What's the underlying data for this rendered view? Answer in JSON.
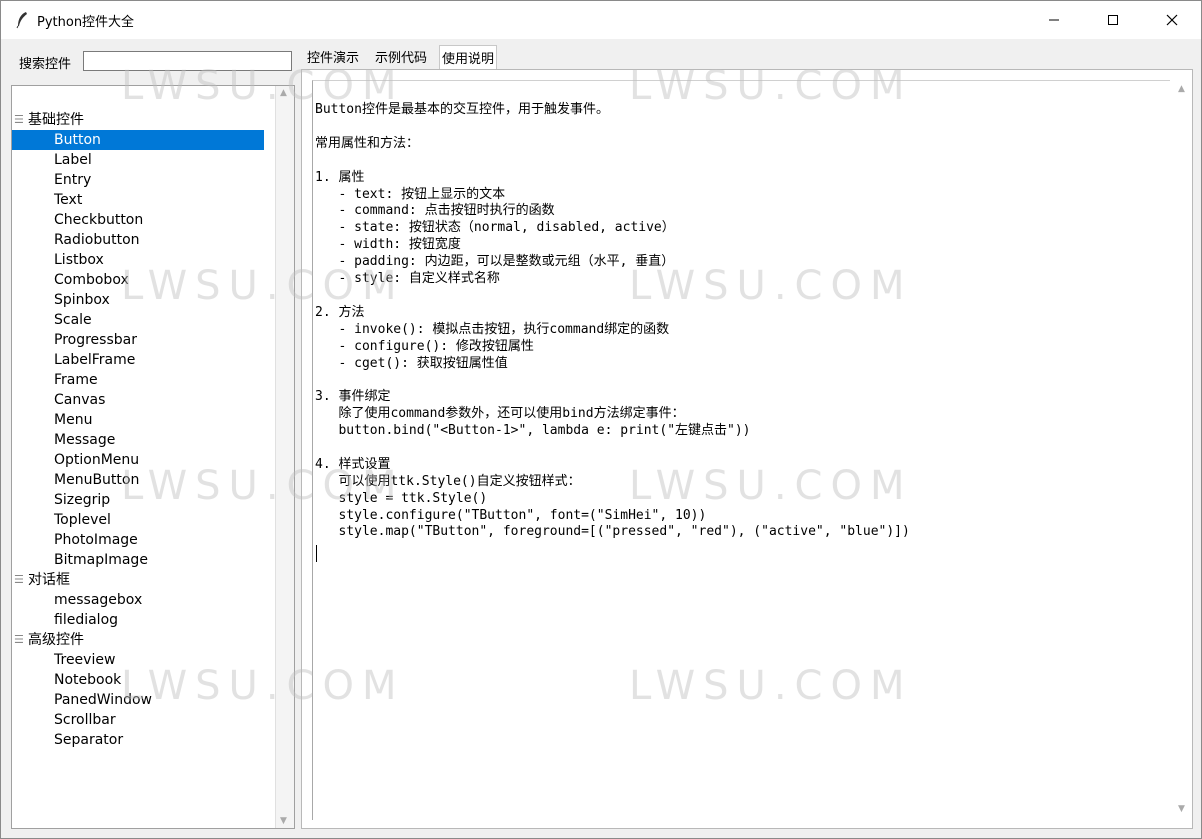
{
  "window": {
    "title": "Python控件大全"
  },
  "search": {
    "label": "搜索控件",
    "value": ""
  },
  "tree": {
    "groups": [
      {
        "label": "基础控件",
        "items": [
          "Button",
          "Label",
          "Entry",
          "Text",
          "Checkbutton",
          "Radiobutton",
          "Listbox",
          "Combobox",
          "Spinbox",
          "Scale",
          "Progressbar",
          "LabelFrame",
          "Frame",
          "Canvas",
          "Menu",
          "Message",
          "OptionMenu",
          "MenuButton",
          "Sizegrip",
          "Toplevel",
          "PhotoImage",
          "BitmapImage"
        ]
      },
      {
        "label": "对话框",
        "items": [
          "messagebox",
          "filedialog"
        ]
      },
      {
        "label": "高级控件",
        "items": [
          "Treeview",
          "Notebook",
          "PanedWindow",
          "Scrollbar",
          "Separator"
        ]
      }
    ],
    "selected": "Button"
  },
  "tabs": [
    {
      "label": "控件演示"
    },
    {
      "label": "示例代码"
    },
    {
      "label": "使用说明"
    }
  ],
  "active_tab": "使用说明",
  "doc": {
    "lines": [
      "Button控件是最基本的交互控件，用于触发事件。",
      "",
      "常用属性和方法：",
      "",
      "1. 属性",
      "   - text: 按钮上显示的文本",
      "   - command: 点击按钮时执行的函数",
      "   - state: 按钮状态（normal, disabled, active）",
      "   - width: 按钮宽度",
      "   - padding: 内边距，可以是整数或元组（水平, 垂直）",
      "   - style: 自定义样式名称",
      "",
      "2. 方法",
      "   - invoke(): 模拟点击按钮，执行command绑定的函数",
      "   - configure(): 修改按钮属性",
      "   - cget(): 获取按钮属性值",
      "",
      "3. 事件绑定",
      "   除了使用command参数外，还可以使用bind方法绑定事件：",
      "   button.bind(\"<Button-1>\", lambda e: print(\"左键点击\"))",
      "",
      "4. 样式设置",
      "   可以使用ttk.Style()自定义按钮样式：",
      "   style = ttk.Style()",
      "   style.configure(\"TButton\", font=(\"SimHei\", 10))",
      "   style.map(\"TButton\", foreground=[(\"pressed\", \"red\"), (\"active\", \"blue\")])"
    ]
  },
  "watermark": "LWSU.COM",
  "colors": {
    "selection": "#0078d7",
    "background": "#f0f0f0",
    "titlebar": "#ffffff"
  }
}
